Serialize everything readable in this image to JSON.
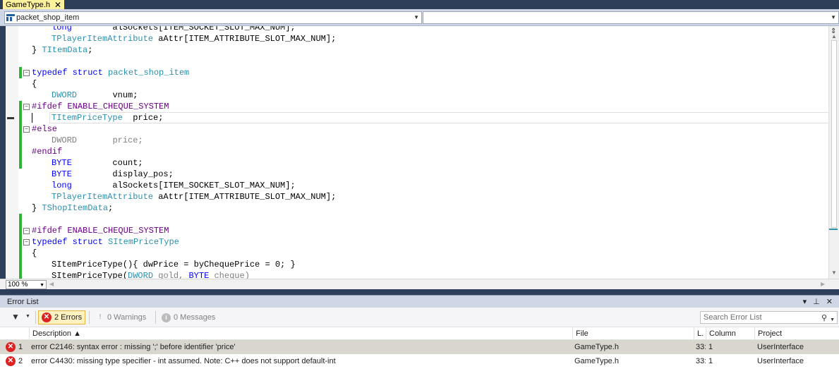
{
  "tab": {
    "title": "GameType.h",
    "close": "✕"
  },
  "nav": {
    "scope": "packet_shop_item",
    "member": ""
  },
  "code": {
    "l0_type": "long",
    "l0_rest": "alSockets[ITEM_SOCKET_SLOT_MAX_NUM];",
    "l1_type": "TPlayerItemAttribute",
    "l1_rest": " aAttr[ITEM_ATTRIBUTE_SLOT_MAX_NUM];",
    "l2_brace": "} ",
    "l2_name": "TItemData",
    "l2_semi": ";",
    "l4_kw": "typedef struct",
    "l4_name": "packet_shop_item",
    "l5": "{",
    "l6_type": "DWORD",
    "l6_rest": "vnum;",
    "l7_pp": "#ifdef",
    "l7_macro": "ENABLE_CHEQUE_SYSTEM",
    "l8_type": "TItemPriceType",
    "l8_rest": "price;",
    "l9_pp": "#else",
    "l10_type": "DWORD",
    "l10_rest": "price;",
    "l11_pp": "#endif",
    "l12_type": "BYTE",
    "l12_rest": "count;",
    "l13_type": "BYTE",
    "l13_rest": "display_pos;",
    "l14_type": "long",
    "l14_rest": "alSockets[ITEM_SOCKET_SLOT_MAX_NUM];",
    "l15_type": "TPlayerItemAttribute",
    "l15_rest": " aAttr[ITEM_ATTRIBUTE_SLOT_MAX_NUM];",
    "l16_brace": "} ",
    "l16_name": "TShopItemData",
    "l16_semi": ";",
    "l18_pp": "#ifdef",
    "l18_macro": "ENABLE_CHEQUE_SYSTEM",
    "l19_kw": "typedef struct",
    "l19_name": "SItemPriceType",
    "l20": "{",
    "l21": "SItemPriceType(){ dwPrice = byChequePrice = 0; }",
    "l22_a": "SItemPriceType(",
    "l22_t1": "DWORD",
    "l22_b": " gold, ",
    "l22_t2": "BYTE",
    "l22_c": " cheque)"
  },
  "zoom": "100 %",
  "panel": {
    "title": "Error List",
    "controls": "▾ ⊥ ✕"
  },
  "toolbar": {
    "errors": "2 Errors",
    "warnings": "0 Warnings",
    "messages": "0 Messages",
    "search_placeholder": "Search Error List"
  },
  "columns": {
    "description": "Description",
    "file": "File",
    "line": "L.",
    "column": "Column",
    "project": "Project"
  },
  "errors": [
    {
      "num": "1",
      "description": "error C2146: syntax error : missing ';' before identifier 'price'",
      "file": "GameType.h",
      "line": "33:",
      "column": "1",
      "project": "UserInterface"
    },
    {
      "num": "2",
      "description": "error C4430: missing type specifier - int assumed. Note: C++ does not support default-int",
      "file": "GameType.h",
      "line": "33:",
      "column": "1",
      "project": "UserInterface"
    }
  ]
}
